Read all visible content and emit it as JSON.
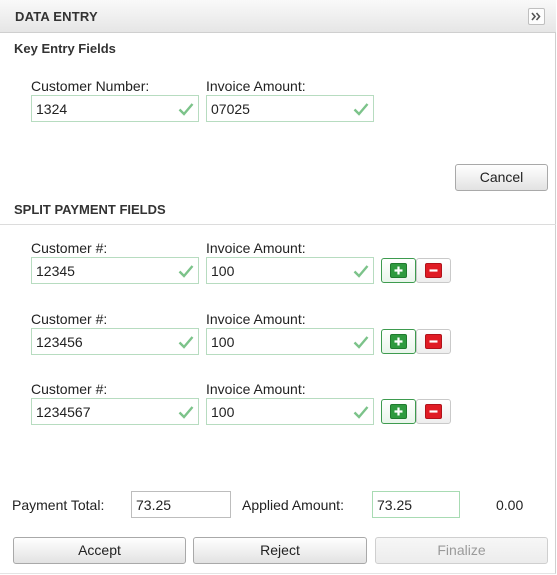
{
  "header": {
    "title": "DATA ENTRY",
    "collapse_icon": "double-chevron-right-icon"
  },
  "key_entry": {
    "title": "Key Entry Fields",
    "customer_number_label": "Customer Number:",
    "customer_number_value": "1324",
    "invoice_amount_label": "Invoice Amount:",
    "invoice_amount_value": "07025",
    "cancel_label": "Cancel"
  },
  "split_payment": {
    "title": "SPLIT PAYMENT FIELDS",
    "rows": [
      {
        "customer_label": "Customer #:",
        "customer_value": "12345",
        "invoice_label": "Invoice Amount:",
        "invoice_value": "100"
      },
      {
        "customer_label": "Customer #:",
        "customer_value": "123456",
        "invoice_label": "Invoice Amount:",
        "invoice_value": "100"
      },
      {
        "customer_label": "Customer #:",
        "customer_value": "1234567",
        "invoice_label": "Invoice Amount:",
        "invoice_value": "100"
      }
    ]
  },
  "totals": {
    "payment_total_label": "Payment Total:",
    "payment_total_value": "73.25",
    "applied_amount_label": "Applied Amount:",
    "applied_amount_input_value": "73.25",
    "applied_amount_display": "0.00"
  },
  "actions": {
    "accept_label": "Accept",
    "reject_label": "Reject",
    "finalize_label": "Finalize"
  },
  "colors": {
    "valid_border": "#b7dcc0",
    "check": "#7cc38a",
    "add_green": "#2f9a3f",
    "remove_red": "#e01b24"
  }
}
